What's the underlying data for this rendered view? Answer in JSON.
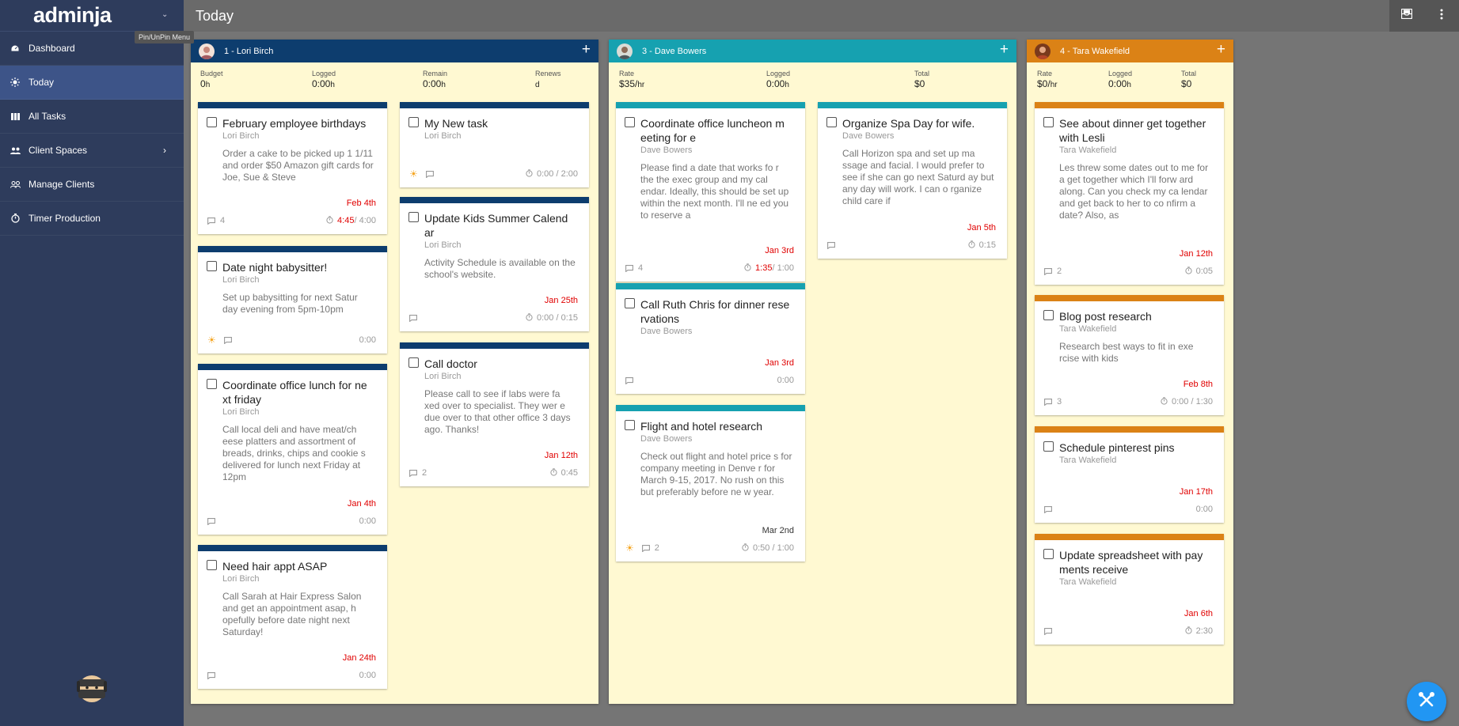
{
  "app": {
    "logo": "adminja",
    "page_title": "Today",
    "pin_tooltip": "Pin/UnPin Menu"
  },
  "sidebar": {
    "items": [
      {
        "label": "Dashboard",
        "icon": "dashboard-icon"
      },
      {
        "label": "Today",
        "icon": "sun-icon",
        "active": true
      },
      {
        "label": "All Tasks",
        "icon": "list-icon"
      },
      {
        "label": "Client Spaces",
        "icon": "people-icon"
      },
      {
        "label": "Manage Clients",
        "icon": "group-icon"
      },
      {
        "label": "Timer Production",
        "icon": "timer-icon"
      }
    ]
  },
  "colors": {
    "sidebar": "#2e3c5c",
    "active": "#3d5488",
    "lori": "#0d3d6e",
    "dave": "#16a1b0",
    "tara": "#db8216",
    "overdue": "#e00000",
    "column_bg": "#fff9d2"
  },
  "columns": [
    {
      "title": "1 - Lori Birch",
      "stats": [
        {
          "label": "Budget",
          "value": "0",
          "unit": "h"
        },
        {
          "label": "Logged",
          "value": "0:00",
          "unit": "h"
        },
        {
          "label": "Remain",
          "value": "0:00",
          "unit": "h"
        },
        {
          "label": "Renews",
          "value": "",
          "unit": "d"
        }
      ]
    },
    {
      "title": "3 - Dave Bowers",
      "stats": [
        {
          "label": "Rate",
          "value": "$35/",
          "unit": "hr"
        },
        {
          "label": "Logged",
          "value": "0:00",
          "unit": "h"
        },
        {
          "label": "Total",
          "value": "$0",
          "unit": ""
        }
      ]
    },
    {
      "title": "4 - Tara Wakefield",
      "stats": [
        {
          "label": "Rate",
          "value": "$0/",
          "unit": "hr"
        },
        {
          "label": "Logged",
          "value": "0:00",
          "unit": "h"
        },
        {
          "label": "Total",
          "value": "$0",
          "unit": ""
        }
      ]
    }
  ],
  "cards": [
    {
      "title": "February employee birthdays",
      "client": "Lori Birch",
      "desc": "Order a cake to be picked up 1 1/11 and order $50 Amazon gift cards for Joe, Sue & Steve",
      "due": "Feb 4th",
      "comments": "4",
      "time_logged": "4:45",
      "time_budget": " / 4:00",
      "sun": false
    },
    {
      "title": "Date night babysitter!",
      "client": "Lori Birch",
      "desc": "Set up babysitting for next Satur day evening from 5pm-10pm",
      "due": "",
      "comments": "",
      "time_logged": "",
      "time_budget": "0:00",
      "sun": true
    },
    {
      "title": "Coordinate office lunch for ne xt friday",
      "client": "Lori Birch",
      "desc": "Call local deli and have meat/ch eese platters and assortment of breads, drinks, chips and cookie s delivered for lunch next Friday at 12pm",
      "due": "Jan 4th",
      "comments": "",
      "time_logged": "",
      "time_budget": "0:00",
      "sun": false
    },
    {
      "title": "Need hair appt ASAP",
      "client": "Lori Birch",
      "desc": "Call Sarah at Hair Express Salon and get an appointment asap, h opefully before date night next Saturday!",
      "due": "Jan 24th",
      "comments": "",
      "time_logged": "",
      "time_budget": "0:00",
      "sun": false
    },
    {
      "title": "My New task",
      "client": "Lori Birch",
      "desc": "",
      "due": "",
      "comments": "",
      "time_logged": "",
      "time_budget": "0:00 / 2:00",
      "sun": true
    },
    {
      "title": "Update Kids Summer Calend ar",
      "client": "Lori Birch",
      "desc": "Activity Schedule is available on the school's website.",
      "due": "Jan 25th",
      "comments": "",
      "time_logged": "",
      "time_budget": "0:00 / 0:15",
      "sun": false
    },
    {
      "title": "Call doctor",
      "client": "Lori Birch",
      "desc": "Please call to see if labs were fa xed over to specialist. They wer e due over to that other office 3 days ago. Thanks!",
      "due": "Jan 12th",
      "comments": "2",
      "time_logged": "",
      "time_budget": "0:45",
      "sun": false
    },
    {
      "title": "Coordinate office luncheon m eeting for e",
      "client": "Dave Bowers",
      "desc": "Please find a date that works fo r the the exec group and my cal endar. Ideally, this should be set up within the next month. I'll ne ed you to reserve a",
      "due": "Jan 3rd",
      "comments": "4",
      "time_logged": "1:35",
      "time_budget": " / 1:00",
      "sun": false
    },
    {
      "title": "Call Ruth Chris for dinner rese rvations",
      "client": "Dave Bowers",
      "desc": "",
      "due": "Jan 3rd",
      "comments": "",
      "time_logged": "",
      "time_budget": "0:00",
      "sun": false
    },
    {
      "title": "Flight and hotel research",
      "client": "Dave Bowers",
      "desc": "Check out flight and hotel price s for company meeting in Denve r for March 9-15, 2017. No rush on this but preferably before ne w year.",
      "due": "Mar 2nd",
      "comments": "2",
      "time_logged": "",
      "time_budget": "0:50 / 1:00",
      "sun": true
    },
    {
      "title": "Organize Spa Day for wife.",
      "client": "Dave Bowers",
      "desc": "Call Horizon spa and set up ma ssage and facial. I would prefer to see if she can go next Saturd ay but any day will work. I can o rganize child care if",
      "due": "Jan 5th",
      "comments": "",
      "time_logged": "",
      "time_budget": "0:15",
      "sun": false
    },
    {
      "title": "See about dinner get together with Lesli",
      "client": "Tara Wakefield",
      "desc": "Les threw some dates out to me for a get together which I'll forw ard along. Can you check my ca lendar and get back to her to co nfirm a date? Also, as",
      "due": "Jan 12th",
      "comments": "2",
      "time_logged": "",
      "time_budget": "0:05",
      "sun": false
    },
    {
      "title": "Blog post research",
      "client": "Tara Wakefield",
      "desc": "Research best ways to fit in exe rcise with kids",
      "due": "Feb 8th",
      "comments": "3",
      "time_logged": "",
      "time_budget": "0:00 / 1:30",
      "sun": false
    },
    {
      "title": "Schedule pinterest pins",
      "client": "Tara Wakefield",
      "desc": "",
      "due": "Jan 17th",
      "comments": "",
      "time_logged": "",
      "time_budget": "0:00",
      "sun": false
    },
    {
      "title": "Update spreadsheet with pay ments receive",
      "client": "Tara Wakefield",
      "desc": "",
      "due": "Jan 6th",
      "comments": "",
      "time_logged": "",
      "time_budget": "2:30",
      "sun": false
    }
  ]
}
